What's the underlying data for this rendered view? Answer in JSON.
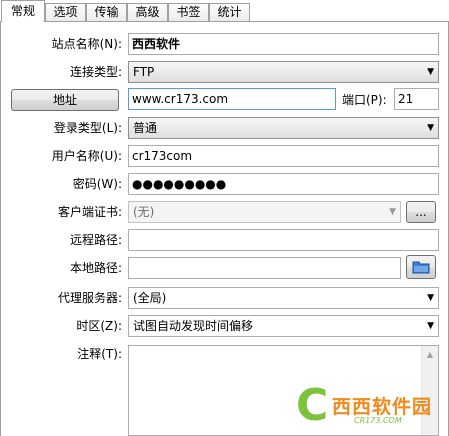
{
  "tabs": [
    {
      "label": "常规",
      "active": true
    },
    {
      "label": "选项"
    },
    {
      "label": "传输"
    },
    {
      "label": "高级"
    },
    {
      "label": "书签"
    },
    {
      "label": "统计"
    }
  ],
  "form": {
    "site_name_label": "站点名称(N):",
    "site_name_value": "西西软件",
    "conn_type_label": "连接类型:",
    "conn_type_value": "FTP",
    "address_button": "地址",
    "address_value": "www.cr173.com",
    "port_label": "端口(P):",
    "port_value": "21",
    "login_type_label": "登录类型(L):",
    "login_type_value": "普通",
    "username_label": "用户名称(U):",
    "username_value": "cr173com",
    "password_label": "密码(W):",
    "password_value": "●●●●●●●●●",
    "client_cert_label": "客户端证书:",
    "client_cert_value": "(无)",
    "browse_button": "...",
    "remote_path_label": "远程路径:",
    "remote_path_value": "",
    "local_path_label": "本地路径:",
    "local_path_value": "",
    "proxy_label": "代理服务器:",
    "proxy_value": "(全局)",
    "timezone_label": "时区(Z):",
    "timezone_value": "试图自动发现时间偏移",
    "notes_label": "注释(T):",
    "notes_value": ""
  },
  "icons": {
    "folder": "folder-icon",
    "dropdown": "chevron-down-icon"
  },
  "watermark": {
    "letter": "C",
    "brand": "西西软件园",
    "site": "CR173.COM"
  },
  "colors": {
    "folder_blue": "#3a7fd5",
    "watermark_green": "#7cc23b",
    "watermark_orange": "#f08a1c"
  }
}
